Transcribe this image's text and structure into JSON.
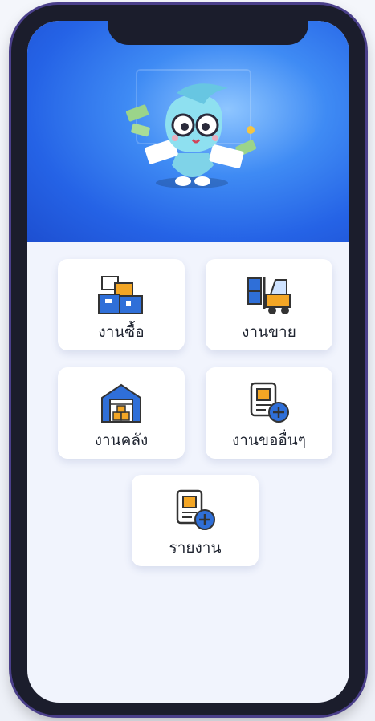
{
  "menu": {
    "purchase": "งานซื้อ",
    "sales": "งานขาย",
    "warehouse": "งานคลัง",
    "other_requests": "งานขออื่นๆ",
    "reports": "รายงาน"
  },
  "colors": {
    "hero_blue": "#2563e6",
    "icon_blue": "#2f6fd8",
    "icon_orange": "#f3a625"
  },
  "icons": [
    "boxes-icon",
    "forklift-icon",
    "warehouse-icon",
    "document-add-icon",
    "report-add-icon"
  ]
}
